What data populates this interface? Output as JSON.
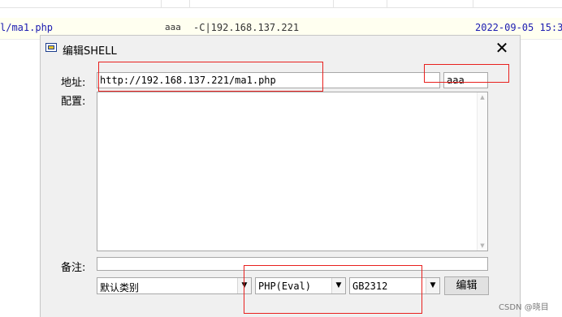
{
  "background_row": {
    "file": "l/ma1.php",
    "password": "aaa",
    "info": "-C|192.168.137.221",
    "date": "2022-09-05 15:3"
  },
  "dialog": {
    "title": "编辑SHELL",
    "address_label": "地址:",
    "address_value": "http://192.168.137.221/ma1.php",
    "password_value": "aaa",
    "config_label": "配置:",
    "config_value": "",
    "note_label": "备注:",
    "note_value": "",
    "category_value": "默认类别",
    "script_type_value": "PHP(Eval)",
    "encoding_value": "GB2312",
    "edit_button": "编辑"
  },
  "icons": {
    "window": "window-icon",
    "close": "close-icon",
    "dropdown": "chevron-down-icon",
    "scroll_up": "scroll-up-icon",
    "scroll_down": "scroll-down-icon"
  },
  "watermark": "CSDN @晓目",
  "colors": {
    "annotation_red": "#e8201e",
    "link_blue": "#1b1bb0",
    "row_highlight": "#fffff0"
  }
}
